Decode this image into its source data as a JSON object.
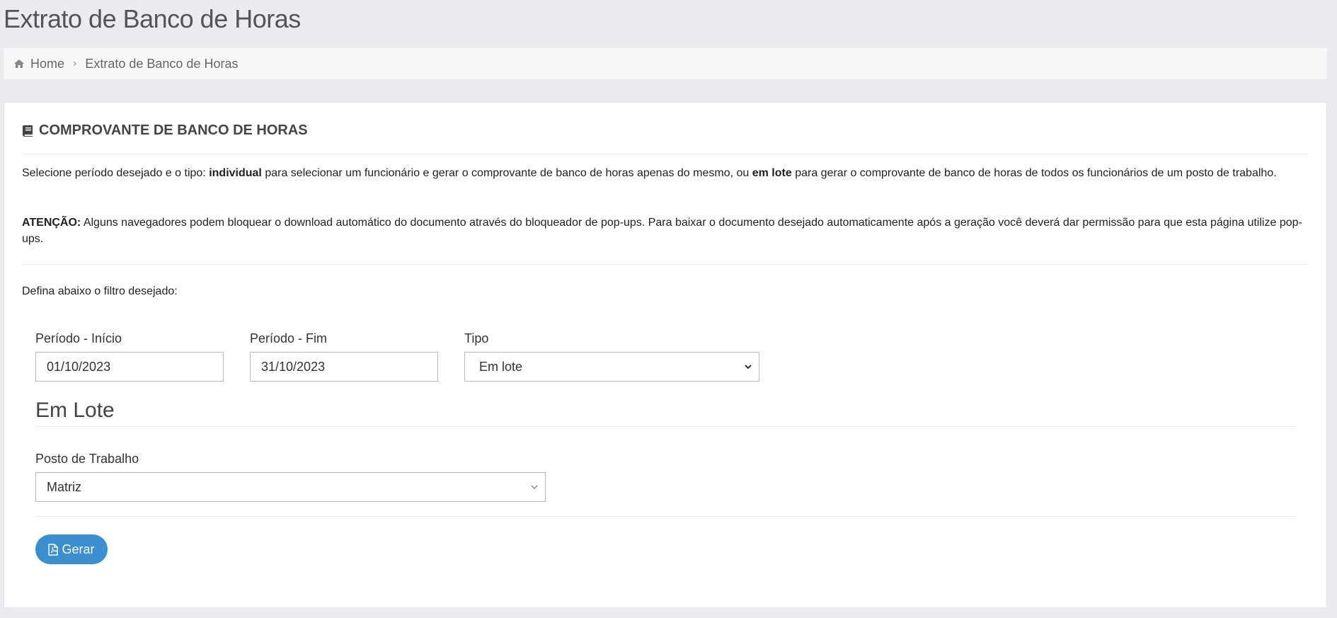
{
  "page": {
    "title": "Extrato de Banco de Horas"
  },
  "breadcrumb": {
    "home": "Home",
    "current": "Extrato de Banco de Horas"
  },
  "panel": {
    "title": "COMPROVANTE DE BANCO DE HORAS",
    "intro": {
      "p1": "Selecione período desejado e o tipo: ",
      "b1": "individual",
      "p2": " para selecionar um funcionário e gerar o comprovante de banco de horas apenas do mesmo, ou ",
      "b2": "em lote",
      "p3": " para gerar o comprovante de banco de horas de todos os funcionários de um posto de trabalho."
    },
    "warning": {
      "label": "ATENÇÃO:",
      "text": " Alguns navegadores podem bloquear o download automático do documento através do bloqueador de pop-ups. Para baixar o documento desejado automaticamente após a geração você deverá dar permissão para que esta página utilize pop-ups."
    },
    "filter_prompt": "Defina abaixo o filtro desejado:"
  },
  "form": {
    "start_label": "Período - Início",
    "start_value": "01/10/2023",
    "end_label": "Período - Fim",
    "end_value": "31/10/2023",
    "type_label": "Tipo",
    "type_value": "Em lote",
    "section_heading": "Em Lote",
    "post_label": "Posto de Trabalho",
    "post_value": "Matriz",
    "generate_label": "Gerar"
  },
  "colors": {
    "primary_button": "#3a8fd1",
    "background": "#ebebf0"
  }
}
